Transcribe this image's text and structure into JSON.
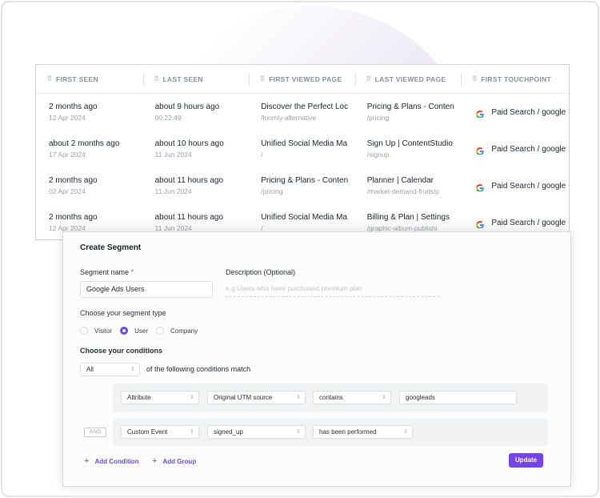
{
  "table": {
    "columns": [
      {
        "label": "FIRST SEEN"
      },
      {
        "label": "LAST SEEN"
      },
      {
        "label": "FIRST VIEWED PAGE"
      },
      {
        "label": "LAST VIEWED PAGE"
      },
      {
        "label": "FIRST TOUCHPOINT"
      }
    ],
    "rows": [
      {
        "first_seen": {
          "main": "2 months ago",
          "sub": "12 Apr 2024"
        },
        "last_seen": {
          "main": "about 9 hours ago",
          "sub": "00:22:49"
        },
        "first_viewed": {
          "main": "Discover the Perfect Loc",
          "sub": "/loomly-alternative"
        },
        "last_viewed": {
          "main": "Pricing & Plans - Conten",
          "sub": "/pricing"
        },
        "touchpoint": {
          "icon": "google-icon",
          "main": "Paid Search / google"
        }
      },
      {
        "first_seen": {
          "main": "about 2 months ago",
          "sub": "17 Apr 2024"
        },
        "last_seen": {
          "main": "about 10 hours ago",
          "sub": "11 Jun 2024"
        },
        "first_viewed": {
          "main": "Unified Social Media Ma",
          "sub": "/"
        },
        "last_viewed": {
          "main": "Sign Up | ContentStudio",
          "sub": "/signup"
        },
        "touchpoint": {
          "icon": "google-icon",
          "main": "Paid Search / google"
        }
      },
      {
        "first_seen": {
          "main": "2 months ago",
          "sub": "02 Apr 2024"
        },
        "last_seen": {
          "main": "about 11 hours ago",
          "sub": "11 Jun 2024"
        },
        "first_viewed": {
          "main": "Pricing & Plans - Conten",
          "sub": "/pricing"
        },
        "last_viewed": {
          "main": "Planner | Calendar",
          "sub": "/market-demand-fruits/p"
        },
        "touchpoint": {
          "icon": "google-icon",
          "main": "Paid Search / google"
        }
      },
      {
        "first_seen": {
          "main": "2 months ago",
          "sub": "12 Apr 2024"
        },
        "last_seen": {
          "main": "about 11 hours ago",
          "sub": "11 Jun 2024"
        },
        "first_viewed": {
          "main": "Unified Social Media Ma",
          "sub": "/"
        },
        "last_viewed": {
          "main": "Billing & Plan | Settings",
          "sub": "/graphic-album-publishi"
        },
        "touchpoint": {
          "icon": "google-icon",
          "main": "Paid Search / google"
        }
      }
    ]
  },
  "modal": {
    "title": "Create Segment",
    "segment_name_label": "Segment name",
    "required_mark": "*",
    "segment_name_value": "Google Ads Users",
    "description_label": "Description (Optional)",
    "description_placeholder": "e.g Users who have purchased premium plan",
    "segment_type_label": "Choose your segment type",
    "segment_types": [
      {
        "label": "Visitor",
        "selected": false
      },
      {
        "label": "User",
        "selected": true
      },
      {
        "label": "Company",
        "selected": false
      }
    ],
    "conditions_label": "Choose your conditions",
    "match_select": "All",
    "match_text": "of the following conditions match",
    "groups": [
      {
        "type": "Attribute",
        "field": "Original UTM source",
        "operator": "contains",
        "value": "googleads"
      },
      {
        "connector": "AND",
        "type": "Custom Event",
        "field": "signed_up",
        "operator": "has been performed"
      }
    ],
    "add_condition": "Add Condition",
    "add_group": "Add Group",
    "update_button": "Update"
  },
  "colors": {
    "accent": "#7543e6",
    "link": "#6b4fd0",
    "required": "#e5484d"
  }
}
